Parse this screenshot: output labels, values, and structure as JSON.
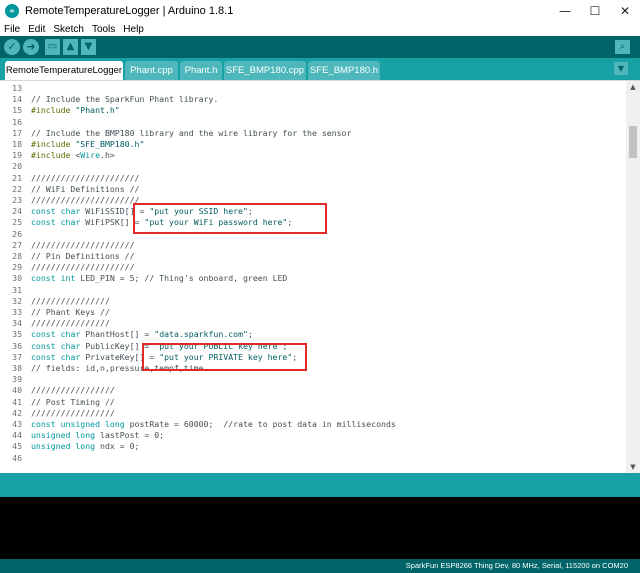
{
  "window": {
    "logo_text": "∞",
    "title": "RemoteTemperatureLogger | Arduino 1.8.1",
    "minimize": "—",
    "maximize": "☐",
    "close": "✕"
  },
  "menu": [
    "File",
    "Edit",
    "Sketch",
    "Tools",
    "Help"
  ],
  "toolbar": {
    "verify_icon": "check-icon",
    "upload_icon": "arrow-right-icon",
    "new_icon": "new-file-icon",
    "open_icon": "arrow-up-icon",
    "save_icon": "arrow-down-icon",
    "serial_monitor_icon": "magnifier-icon"
  },
  "tabs": [
    "RemoteTemperatureLogger",
    "Phant.cpp",
    "Phant.h",
    "SFE_BMP180.cpp",
    "SFE_BMP180.h"
  ],
  "active_tab": 0,
  "code_lines": [
    {
      "n": "13",
      "tokens": []
    },
    {
      "n": "14",
      "tokens": [
        {
          "t": "// Include the SparkFun Phant library.",
          "c": "cm"
        }
      ]
    },
    {
      "n": "15",
      "tokens": [
        {
          "t": "#include",
          "c": "pp"
        },
        {
          "t": " "
        },
        {
          "t": "\"Phant.h\"",
          "c": "str"
        }
      ]
    },
    {
      "n": "16",
      "tokens": []
    },
    {
      "n": "17",
      "tokens": [
        {
          "t": "// Include the BMP180 library and the wire library for the sensor",
          "c": "cm"
        }
      ]
    },
    {
      "n": "18",
      "tokens": [
        {
          "t": "#include",
          "c": "pp"
        },
        {
          "t": " "
        },
        {
          "t": "\"SFE_BMP180.h\"",
          "c": "str"
        }
      ]
    },
    {
      "n": "19",
      "tokens": [
        {
          "t": "#include",
          "c": "pp"
        },
        {
          "t": " <"
        },
        {
          "t": "Wire",
          "c": "kw"
        },
        {
          "t": ".h>"
        }
      ]
    },
    {
      "n": "20",
      "tokens": []
    },
    {
      "n": "21",
      "tokens": [
        {
          "t": "//////////////////////",
          "c": "cm"
        }
      ]
    },
    {
      "n": "22",
      "tokens": [
        {
          "t": "// WiFi Definitions //",
          "c": "cm"
        }
      ]
    },
    {
      "n": "23",
      "tokens": [
        {
          "t": "//////////////////////",
          "c": "cm"
        }
      ]
    },
    {
      "n": "24",
      "tokens": [
        {
          "t": "const",
          "c": "kw"
        },
        {
          "t": " "
        },
        {
          "t": "char",
          "c": "kw"
        },
        {
          "t": " WiFiSSID[] = "
        },
        {
          "t": "\"put your SSID here\"",
          "c": "str"
        },
        {
          "t": ";"
        }
      ]
    },
    {
      "n": "25",
      "tokens": [
        {
          "t": "const",
          "c": "kw"
        },
        {
          "t": " "
        },
        {
          "t": "char",
          "c": "kw"
        },
        {
          "t": " WiFiPSK[] = "
        },
        {
          "t": "\"put your WiFi password here\"",
          "c": "str"
        },
        {
          "t": ";"
        }
      ]
    },
    {
      "n": "26",
      "tokens": []
    },
    {
      "n": "27",
      "tokens": [
        {
          "t": "/////////////////////",
          "c": "cm"
        }
      ]
    },
    {
      "n": "28",
      "tokens": [
        {
          "t": "// Pin Definitions //",
          "c": "cm"
        }
      ]
    },
    {
      "n": "29",
      "tokens": [
        {
          "t": "/////////////////////",
          "c": "cm"
        }
      ]
    },
    {
      "n": "30",
      "tokens": [
        {
          "t": "const",
          "c": "kw"
        },
        {
          "t": " "
        },
        {
          "t": "int",
          "c": "kw"
        },
        {
          "t": " LED_PIN = 5; "
        },
        {
          "t": "// Thing's onboard, green LED",
          "c": "cm"
        }
      ]
    },
    {
      "n": "31",
      "tokens": []
    },
    {
      "n": "32",
      "tokens": [
        {
          "t": "////////////////",
          "c": "cm"
        }
      ]
    },
    {
      "n": "33",
      "tokens": [
        {
          "t": "// Phant Keys //",
          "c": "cm"
        }
      ]
    },
    {
      "n": "34",
      "tokens": [
        {
          "t": "////////////////",
          "c": "cm"
        }
      ]
    },
    {
      "n": "35",
      "tokens": [
        {
          "t": "const",
          "c": "kw"
        },
        {
          "t": " "
        },
        {
          "t": "char",
          "c": "kw"
        },
        {
          "t": " PhantHost[] = "
        },
        {
          "t": "\"data.sparkfun.com\"",
          "c": "str"
        },
        {
          "t": ";"
        }
      ]
    },
    {
      "n": "36",
      "tokens": [
        {
          "t": "const",
          "c": "kw"
        },
        {
          "t": " "
        },
        {
          "t": "char",
          "c": "kw"
        },
        {
          "t": " PublicKey[] = "
        },
        {
          "t": "\"put your PUBLIC key here\"",
          "c": "str"
        },
        {
          "t": ";"
        }
      ]
    },
    {
      "n": "37",
      "tokens": [
        {
          "t": "const",
          "c": "kw"
        },
        {
          "t": " "
        },
        {
          "t": "char",
          "c": "kw"
        },
        {
          "t": " PrivateKey[] = "
        },
        {
          "t": "\"put your PRIVATE key here\"",
          "c": "str"
        },
        {
          "t": ";"
        }
      ]
    },
    {
      "n": "38",
      "tokens": [
        {
          "t": "// fields: id,n,pressure,tempf,time",
          "c": "cm"
        }
      ]
    },
    {
      "n": "39",
      "tokens": []
    },
    {
      "n": "40",
      "tokens": [
        {
          "t": "/////////////////",
          "c": "cm"
        }
      ]
    },
    {
      "n": "41",
      "tokens": [
        {
          "t": "// Post Timing //",
          "c": "cm"
        }
      ]
    },
    {
      "n": "42",
      "tokens": [
        {
          "t": "/////////////////",
          "c": "cm"
        }
      ]
    },
    {
      "n": "43",
      "tokens": [
        {
          "t": "const",
          "c": "kw"
        },
        {
          "t": " "
        },
        {
          "t": "unsigned",
          "c": "kw"
        },
        {
          "t": " "
        },
        {
          "t": "long",
          "c": "kw"
        },
        {
          "t": " postRate = 60000;  "
        },
        {
          "t": "//rate to post data in milliseconds",
          "c": "cm"
        }
      ]
    },
    {
      "n": "44",
      "tokens": [
        {
          "t": "unsigned",
          "c": "kw"
        },
        {
          "t": " "
        },
        {
          "t": "long",
          "c": "kw"
        },
        {
          "t": " lastPost = 0;"
        }
      ]
    },
    {
      "n": "45",
      "tokens": [
        {
          "t": "unsigned",
          "c": "kw"
        },
        {
          "t": " "
        },
        {
          "t": "long",
          "c": "kw"
        },
        {
          "t": " ndx = 0;"
        }
      ]
    },
    {
      "n": "46",
      "tokens": []
    }
  ],
  "status_bar": "SparkFun ESP8266 Thing Dev, 80 MHz, Serial, 115200 on COM20",
  "colors": {
    "toolbar": "#006468",
    "tabbar": "#17a1a5",
    "keyword": "#00979c",
    "preprocessor": "#5e6d03",
    "highlight_box": "#e02a2a"
  }
}
